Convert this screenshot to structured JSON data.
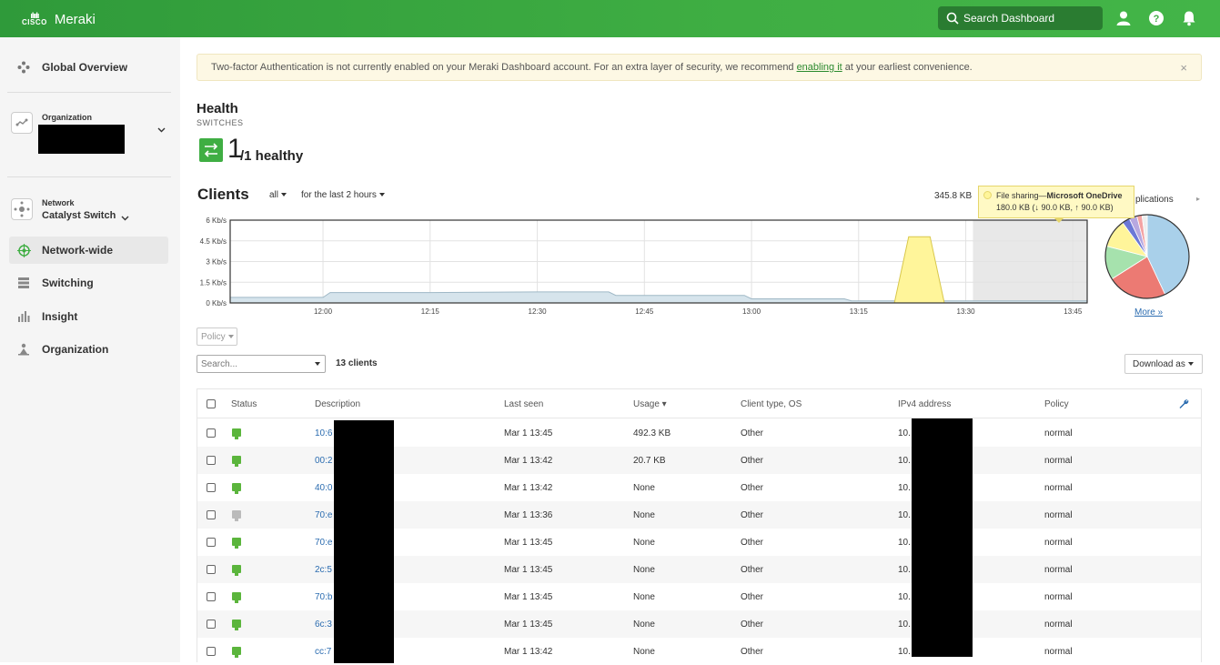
{
  "app": {
    "brand": "Meraki",
    "cisco_label": "CISCO",
    "search_placeholder": "Search Dashboard"
  },
  "sidebar": {
    "global_overview": "Global Overview",
    "organization_label": "Organization",
    "network_label": "Network",
    "network_name": "Catalyst Switch",
    "nav": [
      {
        "label": "Network-wide",
        "icon": "network-wide-icon",
        "active": true
      },
      {
        "label": "Switching",
        "icon": "switching-icon",
        "active": false
      },
      {
        "label": "Insight",
        "icon": "insight-icon",
        "active": false
      },
      {
        "label": "Organization",
        "icon": "organization-icon",
        "active": false
      }
    ]
  },
  "alert": {
    "text_before": "Two-factor Authentication is not currently enabled on your Meraki Dashboard account. For an extra layer of security, we recommend",
    "link": "enabling it",
    "text_after": "at your earliest convenience.",
    "close": "×"
  },
  "health": {
    "title": "Health",
    "subtitle": "SWITCHES",
    "count": "1",
    "rest": "/1 healthy"
  },
  "clients": {
    "title": "Clients",
    "filter": "all",
    "range": "for the last 2 hours",
    "usage_total": "345.8 KB",
    "apps_label": "plications",
    "more": "More »",
    "tooltip_category": "File sharing",
    "tooltip_app": "Microsoft OneDrive",
    "tooltip_detail": "180.0 KB (↓ 90.0 KB, ↑ 90.0 KB)"
  },
  "controls": {
    "policy": "Policy",
    "search_placeholder": "Search...",
    "client_count": "13 clients",
    "download": "Download as"
  },
  "table": {
    "headers": {
      "status": "Status",
      "description": "Description",
      "last_seen": "Last seen",
      "usage": "Usage ▾",
      "client_type": "Client type, OS",
      "ipv4": "IPv4 address",
      "policy": "Policy"
    },
    "rows": [
      {
        "desc": "10:6",
        "last_seen": "Mar 1 13:45",
        "usage": "492.3 KB",
        "type": "Other",
        "ip": "10.",
        "policy": "normal",
        "online": true
      },
      {
        "desc": "00:2",
        "last_seen": "Mar 1 13:42",
        "usage": "20.7 KB",
        "type": "Other",
        "ip": "10.",
        "policy": "normal",
        "online": true
      },
      {
        "desc": "40:0",
        "last_seen": "Mar 1 13:42",
        "usage": "None",
        "type": "Other",
        "ip": "10.",
        "policy": "normal",
        "online": true
      },
      {
        "desc": "70:e",
        "last_seen": "Mar 1 13:36",
        "usage": "None",
        "type": "Other",
        "ip": "10.",
        "policy": "normal",
        "online": false
      },
      {
        "desc": "70:e",
        "last_seen": "Mar 1 13:45",
        "usage": "None",
        "type": "Other",
        "ip": "10.",
        "policy": "normal",
        "online": true
      },
      {
        "desc": "2c:5",
        "last_seen": "Mar 1 13:45",
        "usage": "None",
        "type": "Other",
        "ip": "10.",
        "policy": "normal",
        "online": true
      },
      {
        "desc": "70:b",
        "last_seen": "Mar 1 13:45",
        "usage": "None",
        "type": "Other",
        "ip": "10.",
        "policy": "normal",
        "online": true
      },
      {
        "desc": "6c:3",
        "last_seen": "Mar 1 13:45",
        "usage": "None",
        "type": "Other",
        "ip": "10.",
        "policy": "normal",
        "online": true
      },
      {
        "desc": "cc:7",
        "last_seen": "Mar 1 13:42",
        "usage": "None",
        "type": "Other",
        "ip": "10.",
        "policy": "normal",
        "online": true
      }
    ]
  },
  "colors": {
    "brand_green": "#3fae43",
    "status_online": "#5bb53c",
    "status_offline": "#bbbbbb",
    "link_blue": "#2b6cb0"
  },
  "chart_data": [
    {
      "type": "area",
      "ylabel_ticks": [
        "0 Kb/s",
        "1.5 Kb/s",
        "3 Kb/s",
        "4.5 Kb/s",
        "6 Kb/s"
      ],
      "ylim": [
        0,
        6
      ],
      "x_ticks": [
        "12:00",
        "12:15",
        "12:30",
        "12:45",
        "13:00",
        "13:15",
        "13:30",
        "13:45"
      ],
      "x_range": [
        "11:47",
        "13:47"
      ],
      "grid": true,
      "series": [
        {
          "color": "#d6e4ec",
          "points": [
            [
              "11:47",
              0.4
            ],
            [
              "12:00",
              0.4
            ],
            [
              "12:01",
              0.75
            ],
            [
              "12:15",
              0.75
            ],
            [
              "12:30",
              0.8
            ],
            [
              "12:40",
              0.8
            ],
            [
              "12:41",
              0.55
            ],
            [
              "12:59",
              0.55
            ],
            [
              "13:00",
              0.3
            ],
            [
              "13:13",
              0.3
            ],
            [
              "13:14",
              0.15
            ],
            [
              "13:47",
              0.15
            ]
          ]
        },
        {
          "color": "#fff59a",
          "points": [
            [
              "13:13",
              0.0
            ],
            [
              "13:20",
              0.0
            ],
            [
              "13:22",
              4.8
            ],
            [
              "13:25",
              4.8
            ],
            [
              "13:27",
              0.0
            ]
          ]
        }
      ]
    },
    {
      "type": "pie",
      "values": [
        43,
        23,
        13,
        11,
        3,
        3,
        2,
        2
      ],
      "colors": [
        "#a9d0ea",
        "#ec7a73",
        "#a6e2ad",
        "#fff59a",
        "#6b78d6",
        "#b7a8e0",
        "#f4a3a3",
        "#eeeeee"
      ]
    }
  ]
}
